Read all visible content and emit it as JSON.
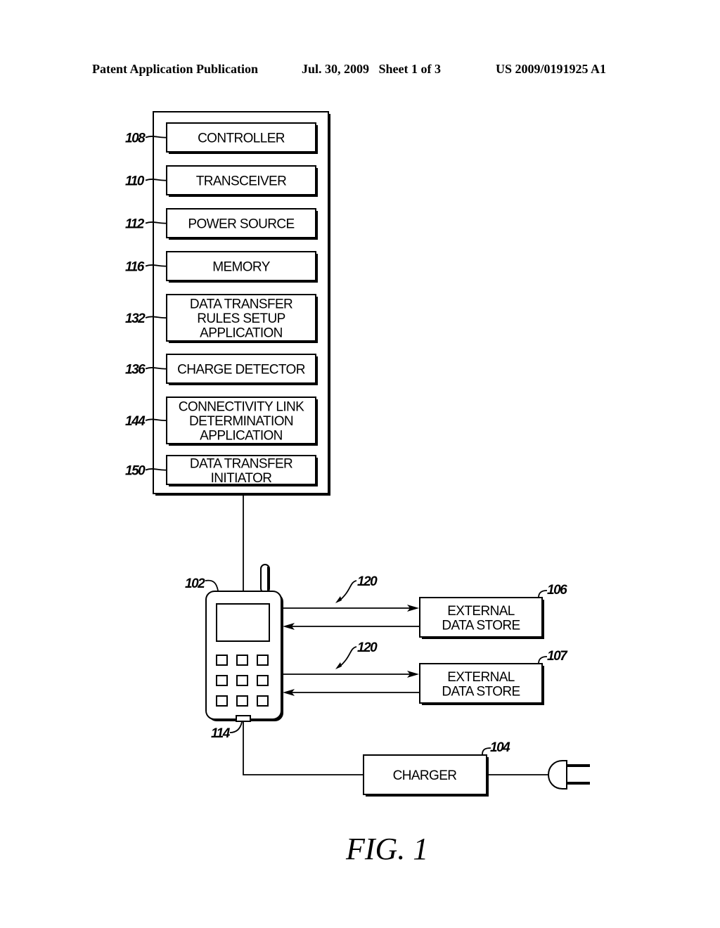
{
  "header": {
    "publication": "Patent Application Publication",
    "date_sheet": "Jul. 30, 2009   Sheet 1 of 3",
    "number": "US 2009/0191925 A1"
  },
  "device_modules": [
    {
      "ref": "108",
      "lines": [
        "CONTROLLER"
      ]
    },
    {
      "ref": "110",
      "lines": [
        "TRANSCEIVER"
      ]
    },
    {
      "ref": "112",
      "lines": [
        "POWER SOURCE"
      ]
    },
    {
      "ref": "116",
      "lines": [
        "MEMORY"
      ]
    },
    {
      "ref": "132",
      "lines": [
        "DATA TRANSFER",
        "RULES SETUP",
        "APPLICATION"
      ]
    },
    {
      "ref": "136",
      "lines": [
        "CHARGE DETECTOR"
      ]
    },
    {
      "ref": "144",
      "lines": [
        "CONNECTIVITY LINK",
        "DETERMINATION",
        "APPLICATION"
      ]
    },
    {
      "ref": "150",
      "lines": [
        "DATA TRANSFER",
        "INITIATOR"
      ]
    }
  ],
  "phone": {
    "ref": "102",
    "port_ref": "114",
    "keypad": "3x3"
  },
  "links": [
    {
      "ref": "120",
      "target": "106"
    },
    {
      "ref": "120",
      "target": "107"
    }
  ],
  "external_stores": [
    {
      "ref": "106",
      "lines": [
        "EXTERNAL",
        "DATA STORE"
      ]
    },
    {
      "ref": "107",
      "lines": [
        "EXTERNAL",
        "DATA STORE"
      ]
    }
  ],
  "charger": {
    "ref": "104",
    "label": "CHARGER",
    "plug_icon": "power-plug-icon"
  },
  "figure_label": "FIG. 1"
}
